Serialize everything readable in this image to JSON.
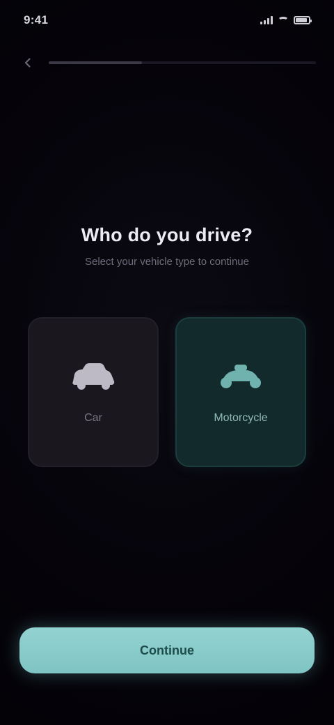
{
  "status_bar": {
    "time": "9:41",
    "battery_level": 0.9
  },
  "nav": {
    "back_icon": "chevron-left-icon",
    "progress": 0.35
  },
  "question": {
    "title": "Who do you drive?",
    "subtitle": "Select your vehicle type to continue"
  },
  "options": [
    {
      "label": "Car",
      "icon": "car-icon",
      "selected": false
    },
    {
      "label": "Motorcycle",
      "icon": "motorcycle-icon",
      "selected": true
    }
  ],
  "cta": {
    "label": "Continue"
  },
  "colors": {
    "background": "#06040a",
    "accent": "#8ccfcd",
    "selected_card": "#122a2b",
    "unselected_card": "#1a171f"
  }
}
